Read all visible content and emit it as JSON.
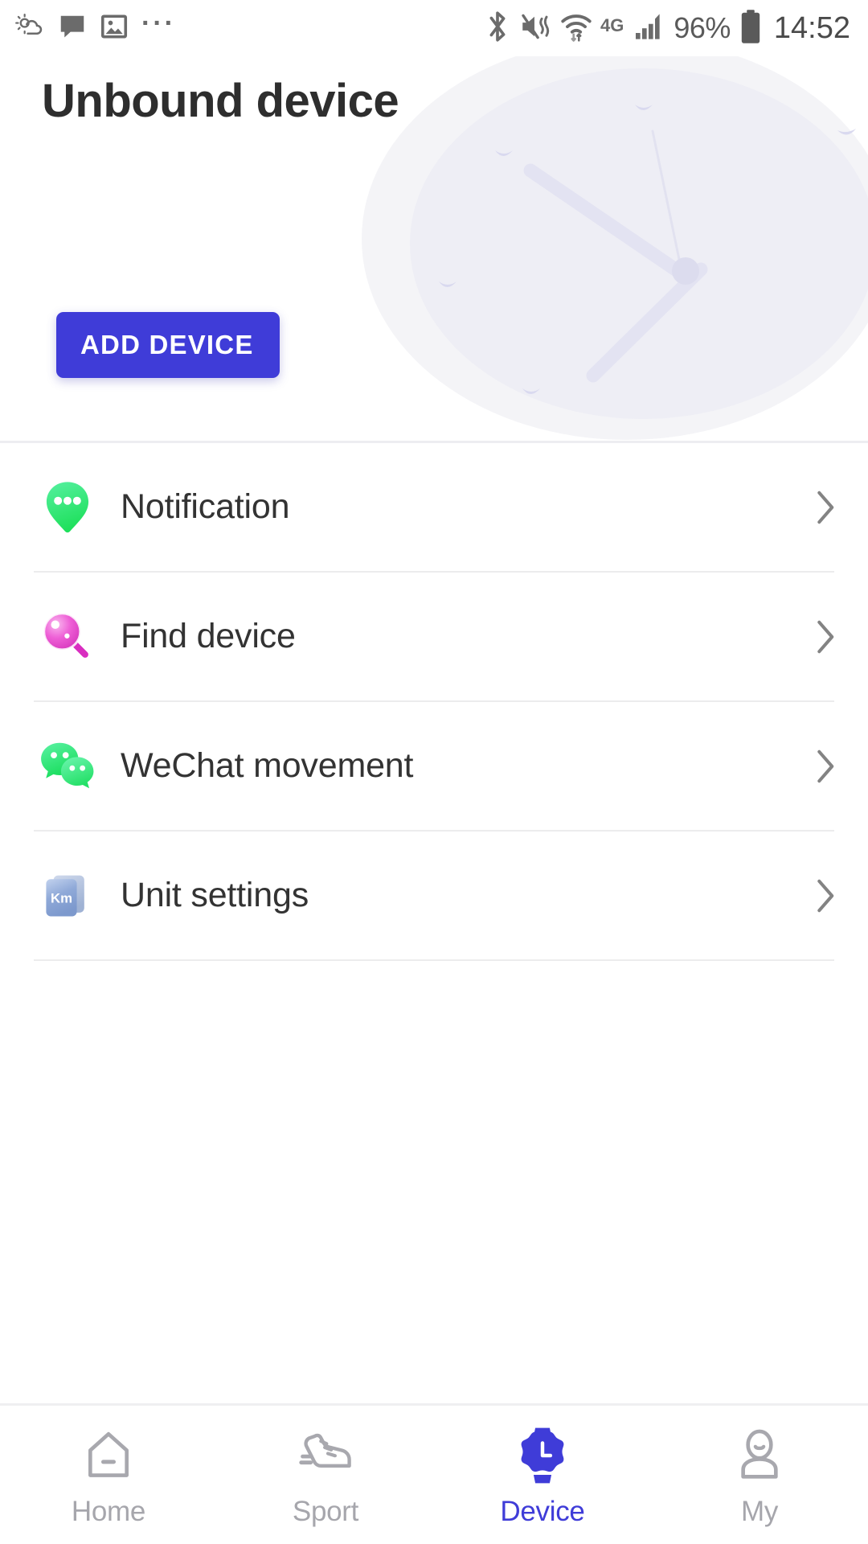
{
  "statusbar": {
    "left_icons": [
      "weather-icon",
      "message-icon",
      "image-icon",
      "more-dots-icon"
    ],
    "right_icons": [
      "bluetooth-icon",
      "vibrate-mute-icon",
      "wifi-icon",
      "signal-bars-icon",
      "battery-icon"
    ],
    "network_type": "4G",
    "battery_percent": "96%",
    "clock": "14:52"
  },
  "header": {
    "title": "Unbound device",
    "add_device_label": "ADD DEVICE",
    "artwork": "watch-face-illustration"
  },
  "list": {
    "items": [
      {
        "label": "Notification",
        "icon": "notification-bubble-icon",
        "chevron": "chevron-right-icon"
      },
      {
        "label": "Find device",
        "icon": "magnifier-icon",
        "chevron": "chevron-right-icon"
      },
      {
        "label": "WeChat movement",
        "icon": "wechat-icon",
        "chevron": "chevron-right-icon"
      },
      {
        "label": "Unit settings",
        "icon": "unit-km-icon",
        "unit_text": "Km",
        "chevron": "chevron-right-icon"
      }
    ]
  },
  "tabbar": {
    "items": [
      {
        "label": "Home",
        "icon": "home-icon",
        "active": false
      },
      {
        "label": "Sport",
        "icon": "shoe-icon",
        "active": false
      },
      {
        "label": "Device",
        "icon": "watch-icon",
        "active": true
      },
      {
        "label": "My",
        "icon": "person-icon",
        "active": false
      }
    ]
  },
  "colors": {
    "accent": "#3F3CD8",
    "text_primary": "#2E2E2E",
    "text_body": "#333333",
    "tab_inactive": "#A6A6AC",
    "divider": "#ECECED"
  }
}
